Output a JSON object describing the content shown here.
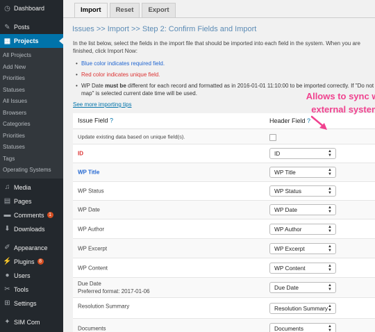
{
  "sidebar": {
    "top_items": [
      {
        "label": "Dashboard",
        "icon": "dashboard-icon"
      },
      {
        "label": "Posts",
        "icon": "pin-icon"
      },
      {
        "label": "Projects",
        "icon": "projects-icon"
      }
    ],
    "sub_items": [
      "All Projects",
      "Add New",
      "Priorities",
      "Statuses",
      "All Issues",
      "Browsers",
      "Categories",
      "Priorities",
      "Statuses",
      "Tags",
      "Operating Systems"
    ],
    "bottom_items": [
      {
        "label": "Media",
        "icon": "media-icon"
      },
      {
        "label": "Pages",
        "icon": "pages-icon"
      },
      {
        "label": "Comments",
        "icon": "comments-icon",
        "badge": "1"
      },
      {
        "label": "Downloads",
        "icon": "download-icon"
      },
      {
        "label": "Appearance",
        "icon": "appearance-icon"
      },
      {
        "label": "Plugins",
        "icon": "plugin-icon",
        "badge": "8"
      },
      {
        "label": "Users",
        "icon": "users-icon"
      },
      {
        "label": "Tools",
        "icon": "tools-icon"
      },
      {
        "label": "Settings",
        "icon": "settings-icon"
      },
      {
        "label": "SIM Com",
        "icon": "sim-icon"
      }
    ]
  },
  "tabs": [
    "Import",
    "Reset",
    "Export"
  ],
  "page_title": "Issues >> Import >> Step 2: Confirm Fields and Import",
  "intro": "In the list below, select the fields in the import file that should be imported into each field in the system. When you are finished, click Import Now:",
  "notes": {
    "blue": "Blue color indicates required field.",
    "red": "Red color indicates unique field.",
    "date_prefix": "WP Date ",
    "date_bold": "must be",
    "date_rest": " different for each record and formatted as in 2016-01-01 11:10:00 to be imported correctly. If \"Do not map\" is selected current date time will be used."
  },
  "tips_link": "See more importing tips",
  "callout": {
    "line1": "Allows to sync with",
    "line2": "external systems"
  },
  "table": {
    "col_issue": "Issue Field",
    "col_header": "Header Field",
    "q": "?",
    "update_label": "Update existing data based on unique field(s).",
    "rows": [
      {
        "name": "ID",
        "value": "ID"
      },
      {
        "name": "WP Title",
        "value": "WP Title"
      },
      {
        "name": "WP Status",
        "value": "WP Status"
      },
      {
        "name": "WP Date",
        "value": "WP Date"
      },
      {
        "name": "WP Author",
        "value": "WP Author"
      },
      {
        "name": "WP Excerpt",
        "value": "WP Excerpt"
      },
      {
        "name": "WP Content",
        "value": "WP Content"
      },
      {
        "name": "Due Date",
        "sub": "Preferred format: 2017-01-06",
        "value": "Due Date"
      },
      {
        "name": "Resolution Summary",
        "value": "Resolution Summary"
      },
      {
        "name": "Documents",
        "value": "Documents"
      }
    ]
  },
  "colors": {
    "sidebar_bg": "#23282d",
    "active": "#0073aa",
    "required": "#2166d1",
    "unique": "#dc3232",
    "callout": "#f0428f"
  }
}
